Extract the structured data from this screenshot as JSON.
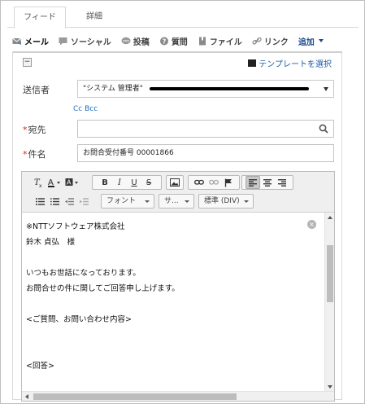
{
  "tabs": [
    {
      "label": "フィード"
    },
    {
      "label": "詳細"
    }
  ],
  "actions": [
    {
      "label": "メール",
      "icon": "mail-icon"
    },
    {
      "label": "ソーシャル",
      "icon": "social-icon"
    },
    {
      "label": "投稿",
      "icon": "post-icon"
    },
    {
      "label": "質問",
      "icon": "question-icon"
    },
    {
      "label": "ファイル",
      "icon": "file-icon"
    },
    {
      "label": "リンク",
      "icon": "link-icon"
    },
    {
      "label": "追加",
      "icon": "chevron-down-icon"
    }
  ],
  "template_link": "テンプレートを選択",
  "form": {
    "sender_label": "送信者",
    "sender_value": "\"システム 管理者\"",
    "cc_bcc": "Cc Bcc",
    "to_label": "宛先",
    "to_value": "",
    "subject_label": "件名",
    "subject_value": "お問合受付番号 00001866"
  },
  "toolbar": {
    "font": "フォント",
    "size": "サ...",
    "format": "標準 (DIV)"
  },
  "body_lines": [
    "※NTTソフトウェア株式会社",
    "鈴木 貞弘　様",
    "",
    "いつもお世話になっております。",
    "お問合せの件に関してご回答申し上げます。",
    "",
    "<ご質問、お問い合わせ内容>",
    "",
    "",
    "<回答>"
  ],
  "colors": {
    "link": "#1f5fa8",
    "required": "#d9230f",
    "brand_blue": "#1d4e8f"
  }
}
